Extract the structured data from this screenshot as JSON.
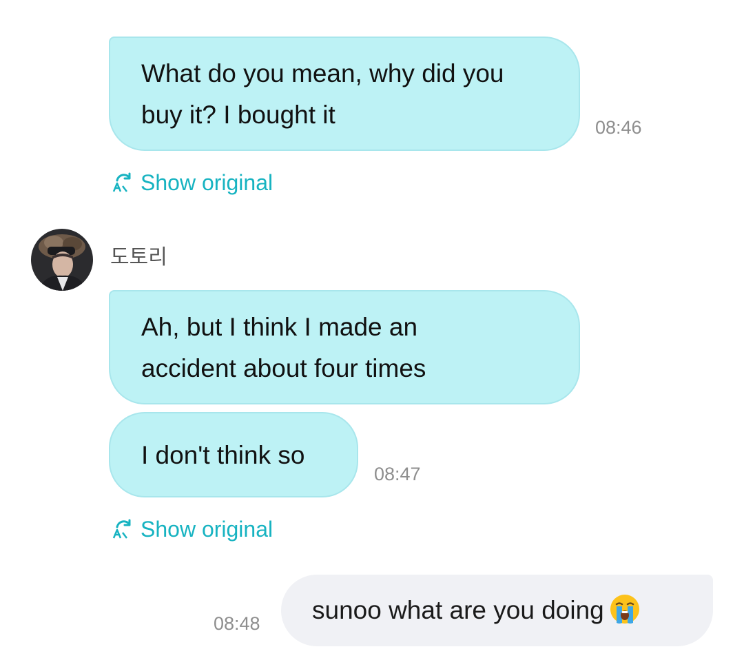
{
  "messages": {
    "m1": {
      "line1": "What do you mean, why did you",
      "line2": "buy it? I bought it",
      "time": "08:46",
      "show_original": "Show original"
    },
    "sender": {
      "name": "도토리"
    },
    "m2": {
      "line1": "Ah, but I think I made an",
      "line2": "accident about four times"
    },
    "m3": {
      "text": "I don't think so",
      "time": "08:47",
      "show_original": "Show original"
    },
    "m4": {
      "text": "sunoo what are you doing",
      "emoji": "loudly-crying-face-emoji",
      "time": "08:48"
    }
  },
  "icons": {
    "translate": "translate-icon"
  },
  "colors": {
    "incoming_bubble": "#bdf2f5",
    "outgoing_bubble": "#f0f1f5",
    "accent": "#17b3c1",
    "timestamp": "#8e8e8e"
  }
}
